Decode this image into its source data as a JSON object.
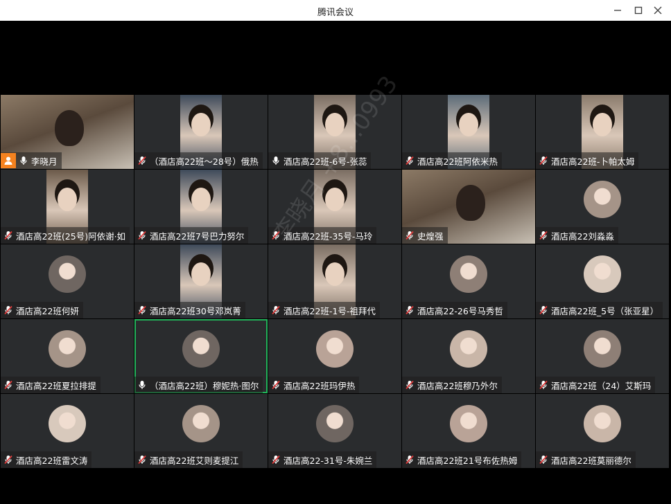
{
  "window": {
    "title": "腾讯会议"
  },
  "watermark": "李晓月 +8…0993",
  "participants": [
    {
      "name": "李晓月",
      "mic": "on",
      "host": true,
      "video": "room"
    },
    {
      "name": "（酒店高22班～28号）俄热",
      "mic": "off",
      "video": "face"
    },
    {
      "name": "酒店高22班-6号-张蕊",
      "mic": "on",
      "video": "face"
    },
    {
      "name": "酒店高22班阿依米热",
      "mic": "off",
      "video": "face"
    },
    {
      "name": "酒店高22班-卜帕太姆",
      "mic": "off",
      "video": "face"
    },
    {
      "name": "酒店高22班(25号)阿依谢·如",
      "mic": "off",
      "video": "face"
    },
    {
      "name": "酒店高22班7号巴力努尔",
      "mic": "off",
      "video": "face"
    },
    {
      "name": "酒店高22班-35号-马玲",
      "mic": "off",
      "video": "face"
    },
    {
      "name": "史煌强",
      "mic": "off",
      "video": "room"
    },
    {
      "name": "酒店高22刘淼淼",
      "mic": "off",
      "video": "avatar"
    },
    {
      "name": "酒店高22班何妍",
      "mic": "off",
      "video": "avatar"
    },
    {
      "name": "酒店高22班30号邓岚菁",
      "mic": "off",
      "video": "face"
    },
    {
      "name": "酒店高22班-1号-祖拜代",
      "mic": "off",
      "video": "face"
    },
    {
      "name": "酒店高22-26号马秀哲",
      "mic": "off",
      "video": "avatar"
    },
    {
      "name": "酒店高22班_5号（张亚星）",
      "mic": "off",
      "video": "avatar"
    },
    {
      "name": "酒店高22班夏拉排提",
      "mic": "off",
      "video": "avatar"
    },
    {
      "name": "（酒店高22班）穆妮热·图尔",
      "mic": "on",
      "speaking": true,
      "video": "avatar"
    },
    {
      "name": "酒店高22班玛伊热",
      "mic": "off",
      "video": "avatar"
    },
    {
      "name": "酒店高22班穆乃外尔",
      "mic": "off",
      "video": "avatar"
    },
    {
      "name": "酒店高22班（24）艾斯玛",
      "mic": "off",
      "video": "avatar"
    },
    {
      "name": "酒店高22班雷文涛",
      "mic": "off",
      "video": "avatar"
    },
    {
      "name": "酒店高22班艾则麦提江",
      "mic": "off",
      "video": "avatar"
    },
    {
      "name": "酒店高22-31号-朱婉兰",
      "mic": "off",
      "video": "avatar"
    },
    {
      "name": "酒店高22班21号布佐热姆",
      "mic": "off",
      "video": "avatar"
    },
    {
      "name": "酒店高22班莫丽德尔",
      "mic": "off",
      "video": "avatar"
    }
  ],
  "colors": {
    "speaking": "#22b35a",
    "host_badge": "#f5821f",
    "tile_bg": "#2a2c2e",
    "mic_off": "#e03b3b"
  }
}
